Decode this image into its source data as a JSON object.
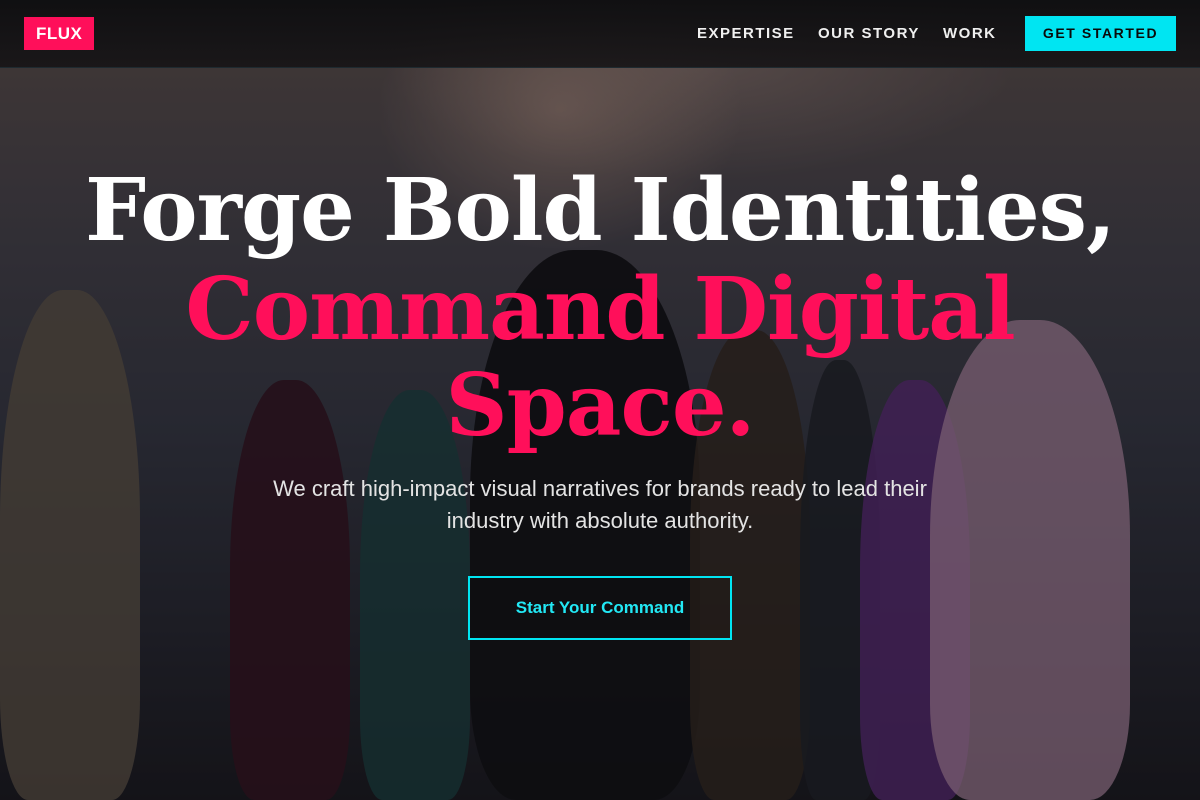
{
  "nav": {
    "logo": "FLUX",
    "links": [
      "EXPERTISE",
      "OUR STORY",
      "WORK"
    ],
    "cta": "GET STARTED"
  },
  "hero": {
    "headline_line1": "Forge Bold Identities,",
    "headline_line2": "Command Digital",
    "headline_line3": "Space.",
    "subtitle": "We craft high-impact visual narratives for brands ready to lead their industry with absolute authority.",
    "cta": "Start Your Command"
  },
  "colors": {
    "accent_pink": "#ff0f5a",
    "accent_cyan": "#00e5f2",
    "nav_bg": "#141416"
  }
}
